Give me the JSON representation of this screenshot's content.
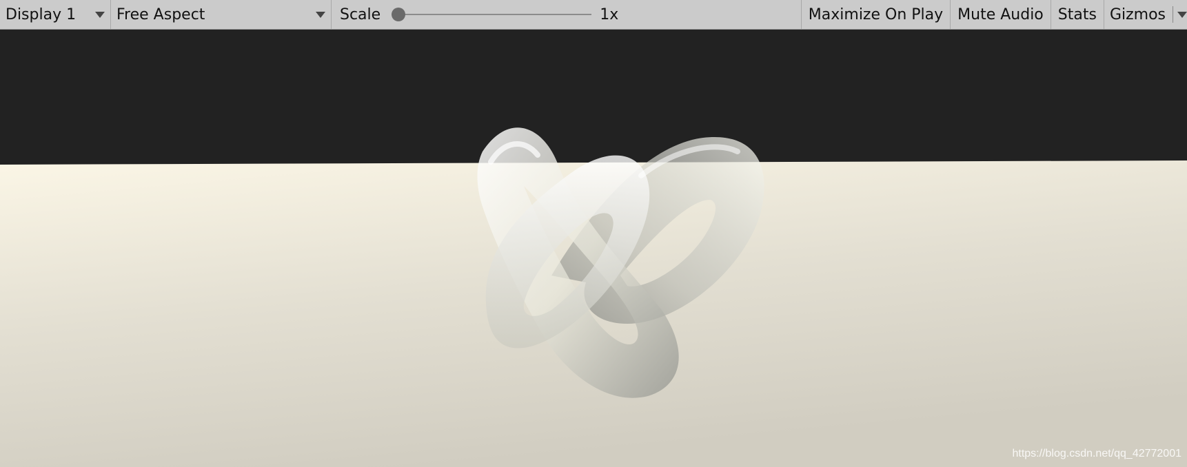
{
  "toolbar": {
    "display_label": "Display 1",
    "aspect_label": "Free Aspect",
    "scale_label": "Scale",
    "scale_value": "1x",
    "scale_level": 0,
    "maximize_label": "Maximize On Play",
    "mute_label": "Mute Audio",
    "stats_label": "Stats",
    "gizmos_label": "Gizmos"
  },
  "scene": {
    "sky_color": "#222222",
    "ground_color": "#e4e0d4",
    "object": "knot-torus"
  },
  "watermark": "https://blog.csdn.net/qq_42772001",
  "icons": {
    "dropdown": "chevron-down-icon"
  }
}
